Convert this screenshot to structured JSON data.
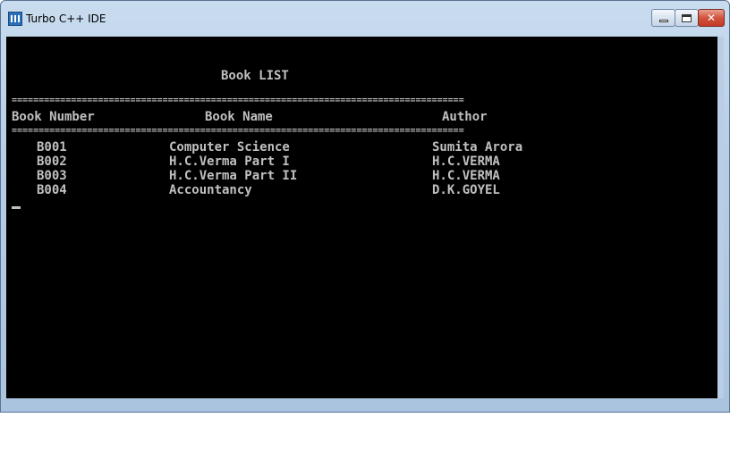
{
  "window": {
    "title": "Turbo C++ IDE",
    "close_glyph": "✕"
  },
  "console": {
    "heading": "Book LIST",
    "separator": "====================================================================================",
    "columns": {
      "number": "Book Number",
      "name": "Book Name",
      "author": "Author"
    },
    "rows": [
      {
        "number": "B001",
        "name": "Computer Science",
        "author": "Sumita Arora"
      },
      {
        "number": "B002",
        "name": "H.C.Verma Part I",
        "author": "H.C.VERMA"
      },
      {
        "number": "B003",
        "name": "H.C.Verma Part II",
        "author": "H.C.VERMA"
      },
      {
        "number": "B004",
        "name": "Accountancy",
        "author": "D.K.GOYEL"
      }
    ],
    "cursor": "_"
  },
  "colors": {
    "console_bg": "#000000",
    "console_text": "#c0c0c0"
  }
}
